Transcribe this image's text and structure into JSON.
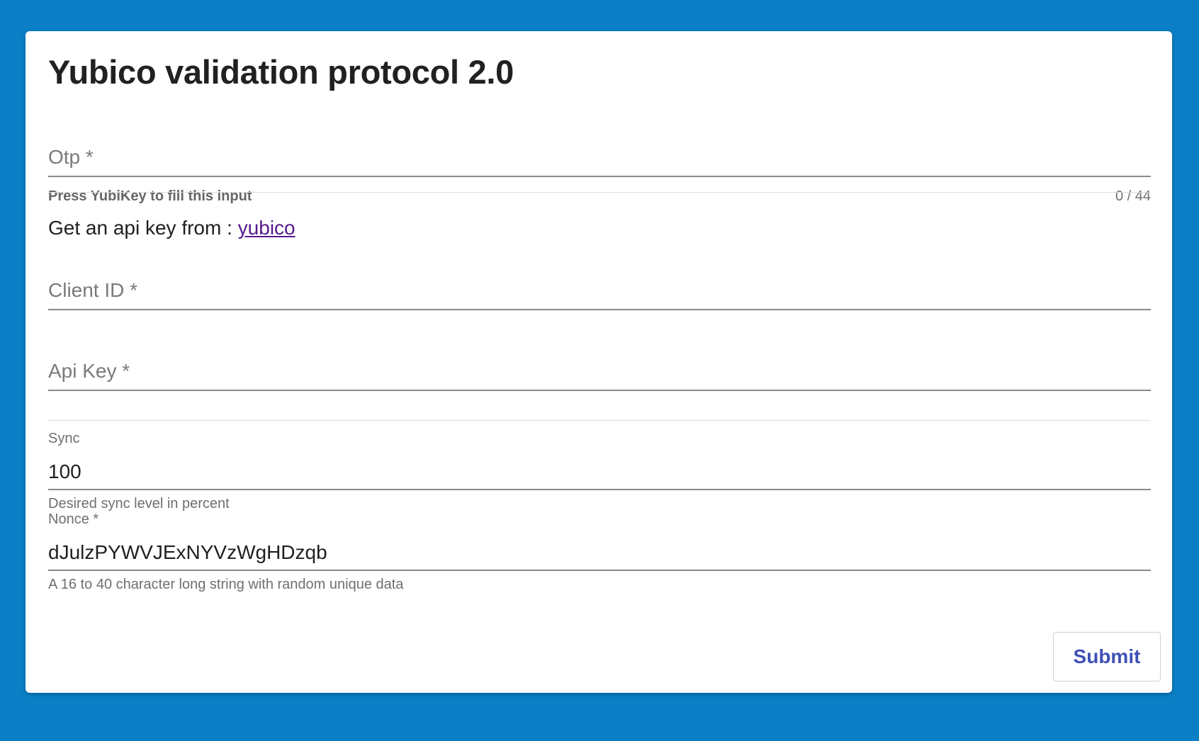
{
  "page": {
    "title": "Yubico validation protocol 2.0"
  },
  "otp": {
    "placeholder": "Otp *",
    "hint": "Press YubiKey to fill this input",
    "counter": "0 / 44"
  },
  "apikey_info": {
    "text": "Get an api key from : ",
    "link_label": "yubico"
  },
  "client_id": {
    "placeholder": "Client ID *"
  },
  "api_key": {
    "placeholder": "Api Key *"
  },
  "sync": {
    "label": "Sync",
    "value": "100",
    "hint": "Desired sync level in percent"
  },
  "nonce": {
    "label": "Nonce *",
    "value": "dJulzPYWVJExNYVzWgHDzqb",
    "hint": "A 16 to 40 character long string with random unique data"
  },
  "actions": {
    "submit_label": "Submit"
  },
  "colors": {
    "background": "#0a7fc6",
    "card": "#ffffff",
    "link": "#551a8b",
    "button_text": "#3f51b5"
  }
}
